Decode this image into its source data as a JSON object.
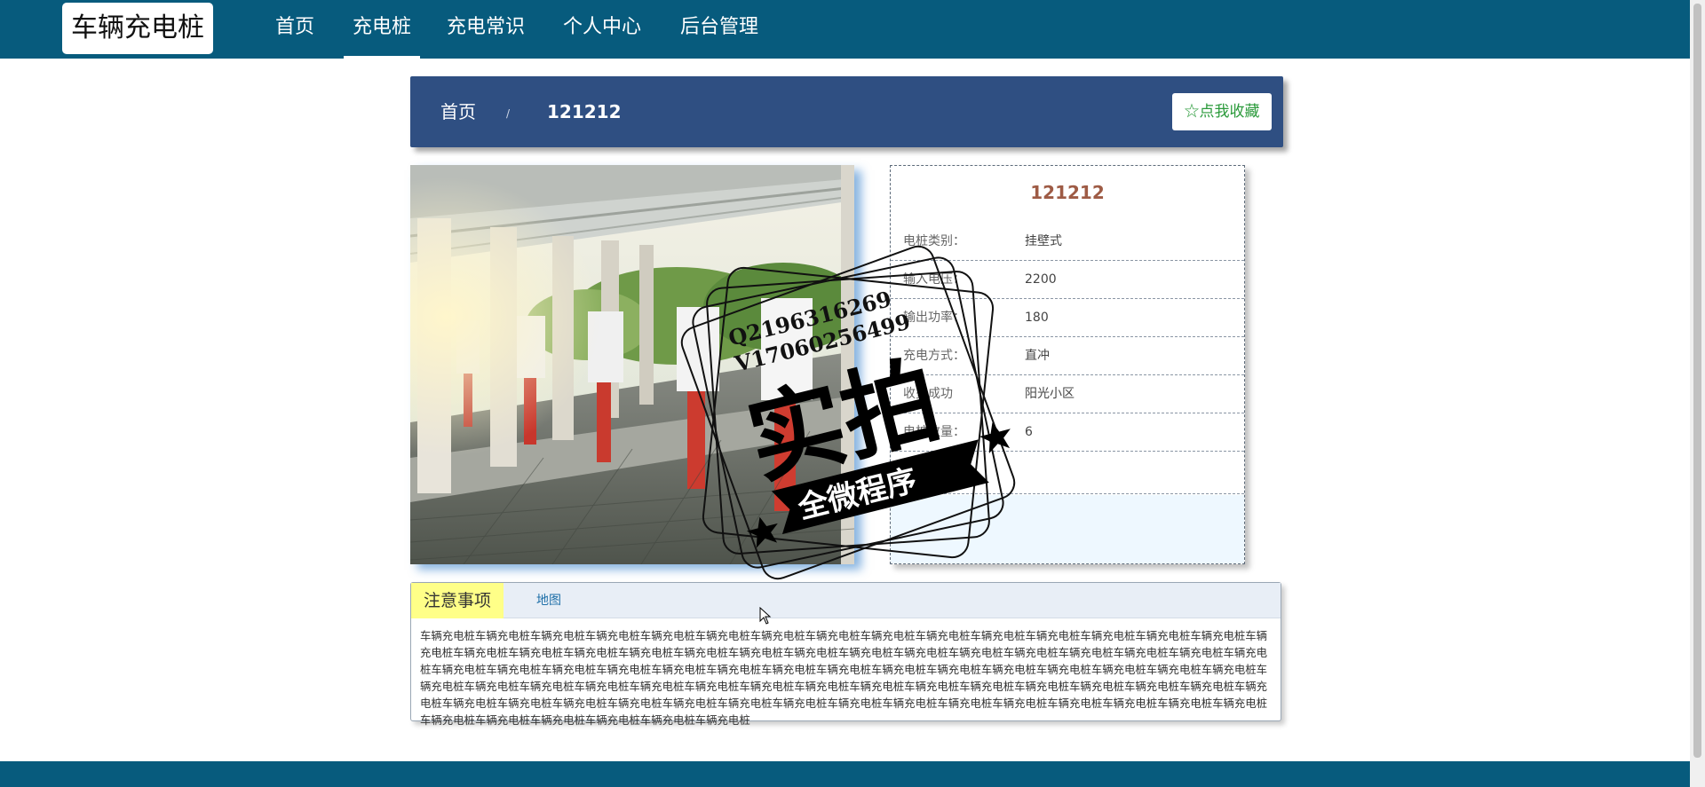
{
  "header": {
    "logo": "车辆充电桩",
    "nav": [
      {
        "label": "首页"
      },
      {
        "label": "充电桩"
      },
      {
        "label": "充电常识"
      },
      {
        "label": "个人中心"
      },
      {
        "label": "后台管理"
      }
    ],
    "active_index": 1
  },
  "breadcrumb": {
    "home": "首页",
    "separator": "/",
    "current": "121212",
    "favorite_button": "☆点我收藏"
  },
  "detail": {
    "title": "121212",
    "rows": [
      {
        "label": "电桩类别：",
        "value": "挂壁式"
      },
      {
        "label": "输入电压：",
        "value": "2200"
      },
      {
        "label": "输出功率：",
        "value": "180"
      },
      {
        "label": "充电方式：",
        "value": "直冲"
      },
      {
        "label": "收费成功",
        "value": "阳光小区"
      },
      {
        "label": "电桩数量：",
        "value": "6"
      }
    ]
  },
  "tabs": {
    "items": [
      {
        "label": "注意事项"
      },
      {
        "label": "地图"
      }
    ],
    "content": "车辆充电桩车辆充电桩车辆充电桩车辆充电桩车辆充电桩车辆充电桩车辆充电桩车辆充电桩车辆充电桩车辆充电桩车辆充电桩车辆充电桩车辆充电桩车辆充电桩车辆充电桩车辆充电桩车辆充电桩车辆充电桩车辆充电桩车辆充电桩车辆充电桩车辆充电桩车辆充电桩车辆充电桩车辆充电桩车辆充电桩车辆充电桩车辆充电桩车辆充电桩车辆充电桩车辆充电桩车辆充电桩车辆充电桩车辆充电桩车辆充电桩车辆充电桩车辆充电桩车辆充电桩车辆充电桩车辆充电桩车辆充电桩车辆充电桩车辆充电桩车辆充电桩车辆充电桩车辆充电桩车辆充电桩车辆充电桩车辆充电桩车辆充电桩车辆充电桩车辆充电桩车辆充电桩车辆充电桩车辆充电桩车辆充电桩车辆充电桩车辆充电桩车辆充电桩车辆充电桩车辆充电桩车辆充电桩车辆充电桩车辆充电桩车辆充电桩车辆充电桩车辆充电桩车辆充电桩车辆充电桩车辆充电桩车辆充电桩车辆充电桩车辆充电桩车辆充电桩车辆充电桩车辆充电桩车辆充电桩车辆充电桩车辆充电桩车辆充电桩车辆充电桩车辆充电桩车辆充电桩"
  },
  "watermark": {
    "line1": "Q2196316269",
    "line2": "V17060256499",
    "big": "实拍",
    "banner": "全微程序"
  },
  "colors": {
    "nav_bg": "#075b7d",
    "crumb_bg": "#2f4f82",
    "title_accent": "#9e5b45",
    "tab_active_bg": "#ffff88",
    "favorite_text": "#2a9a3a"
  }
}
